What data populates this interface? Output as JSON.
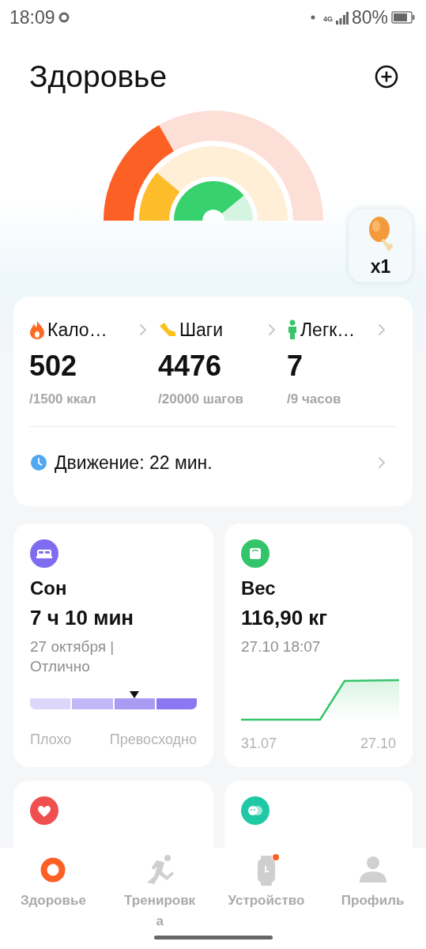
{
  "status_bar": {
    "time": "18:09",
    "network": "4G",
    "battery": "80%"
  },
  "header": {
    "title": "Здоровье"
  },
  "reward": {
    "count": "x1"
  },
  "summary": {
    "metrics": [
      {
        "kind": "calories",
        "label": "Кало…",
        "value": "502",
        "goal": "/1500 ккал"
      },
      {
        "kind": "steps",
        "label": "Шаги",
        "value": "4476",
        "goal": "/20000 шагов"
      },
      {
        "kind": "standing",
        "label": "Легк…",
        "value": "7",
        "goal": "/9 часов"
      }
    ],
    "movement": "Движение: 22 мин."
  },
  "tiles": [
    {
      "kind": "sleep",
      "title": "Сон",
      "value": "7 ч 10 мин",
      "detail": "27 октября | Отлично",
      "scale": [
        {
          "color": "#dcd7fa",
          "selected": false
        },
        {
          "color": "#c1b8f8",
          "selected": false
        },
        {
          "color": "#a89cf5",
          "selected": true
        },
        {
          "color": "#8a78f2",
          "selected": false
        }
      ],
      "scale_min": "Плохо",
      "scale_max": "Превосходно"
    },
    {
      "kind": "weight",
      "title": "Вес",
      "value": "116,90 кг",
      "detail": "27.10 18:07",
      "x_start": "31.07",
      "x_end": "27.10"
    },
    {
      "kind": "pulse"
    },
    {
      "kind": "stress"
    }
  ],
  "nav": [
    {
      "kind": "health",
      "label": "Здоровье",
      "selected": true,
      "badge": false
    },
    {
      "kind": "workout",
      "label": "Тренировка",
      "selected": false,
      "badge": false
    },
    {
      "kind": "device",
      "label": "Устройство",
      "selected": false,
      "badge": true
    },
    {
      "kind": "profile",
      "label": "Профиль",
      "selected": false,
      "badge": false
    }
  ]
}
